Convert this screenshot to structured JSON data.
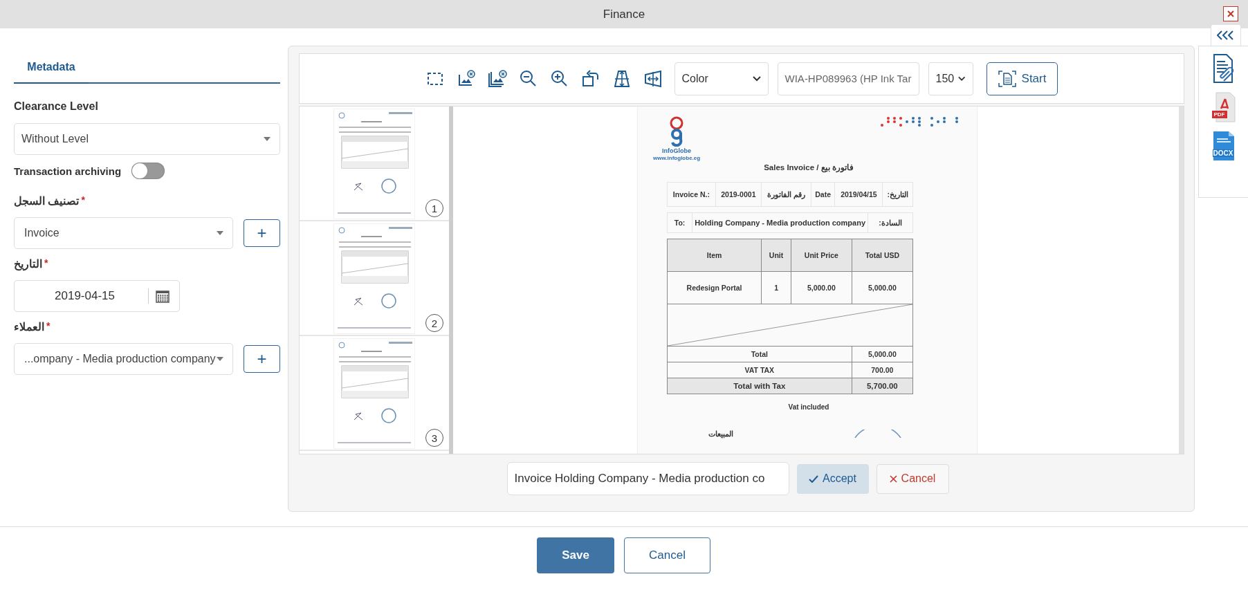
{
  "window": {
    "title": "Finance"
  },
  "tabs": [
    {
      "label": "Metadata",
      "selected": true
    }
  ],
  "fields": [
    {
      "kind": "select",
      "label": "Clearance Level",
      "value": "Without Level"
    },
    {
      "kind": "toggle",
      "label": "Transaction archiving",
      "on": false
    },
    {
      "kind": "select",
      "label": "تصنيف السجل",
      "required_mark": "*",
      "value": "Invoice",
      "add_button": "+"
    },
    {
      "kind": "date",
      "label": "التاريخ",
      "required_mark": "*",
      "value": "2019-04-15"
    },
    {
      "kind": "select",
      "label": "العملاء",
      "required_mark": "*",
      "value": "...ompany - Media production company",
      "add_button": "+"
    }
  ],
  "scanner": {
    "color_mode": "Color",
    "device": "WIA-HP089963 (HP Ink Tar",
    "resolution": "150",
    "start_button": "Start"
  },
  "pages": [
    {
      "number": "1"
    },
    {
      "number": "2"
    },
    {
      "number": "3"
    }
  ],
  "document": {
    "logo": "InfoGlobe",
    "website": "www.infoglobe.eg",
    "title": "Sales Invoice / فاتورة بيع",
    "meta": [
      "Invoice N.:",
      "2019-0001",
      "رقم الفاتورة",
      "Date",
      "2019/04/15",
      "التاريخ:"
    ],
    "to": [
      "To:",
      "Holding Company - Media production company",
      "السادة:"
    ],
    "columns": [
      "Item",
      "Unit",
      "Unit Price",
      "Total USD"
    ],
    "rows": [
      [
        "Redesign Portal",
        "1",
        "5,000.00",
        "5,000.00"
      ]
    ],
    "totals": [
      {
        "label": "Total",
        "value": "5,000.00",
        "highlight": false
      },
      {
        "label": "VAT TAX",
        "value": "700.00",
        "highlight": false
      },
      {
        "label": "Total with Tax",
        "value": "5,700.00",
        "highlight": true
      }
    ],
    "note": "Vat included",
    "signature": "المبيعات"
  },
  "name_field": {
    "value": "Invoice Holding Company - Media production co"
  },
  "scan_actions": {
    "accept": "Accept",
    "cancel": "Cancel"
  },
  "side_tools": [
    {
      "kind": "attachment"
    },
    {
      "kind": "pdf",
      "label": "PDF"
    },
    {
      "kind": "docx",
      "label": "DOCX"
    }
  ],
  "footer": {
    "save": "Save",
    "cancel": "Cancel"
  }
}
